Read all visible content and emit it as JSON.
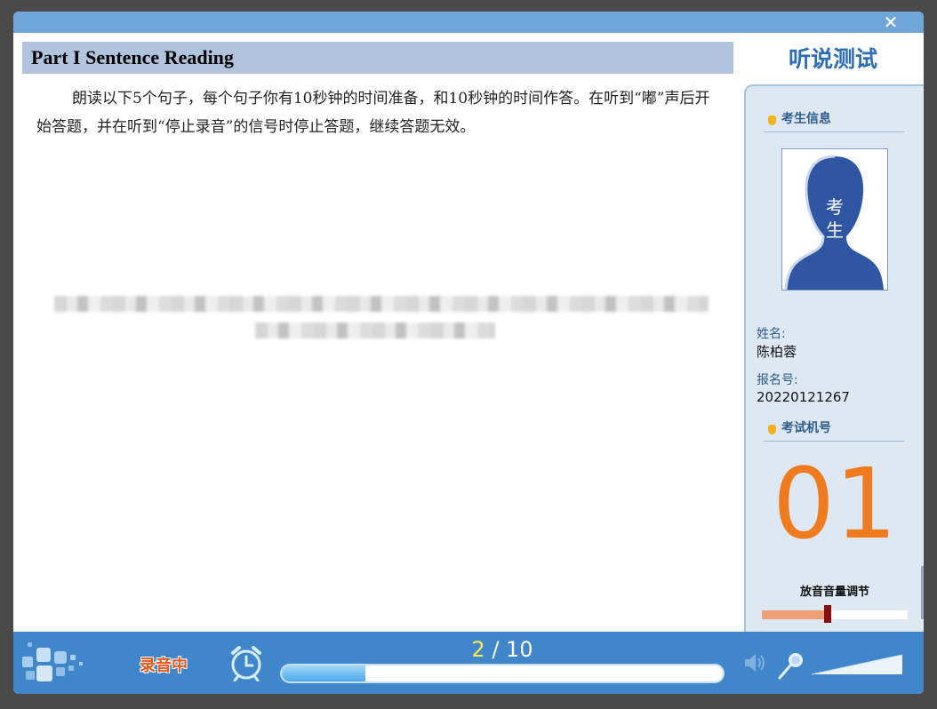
{
  "window": {
    "close_symbol": "✕"
  },
  "main": {
    "part_title": "Part I Sentence Reading",
    "instructions": "朗读以下5个句子，每个句子你有10秒钟的时间准备，和10秒钟的时间作答。在听到“嘟”声后开始答题，并在听到“停止录音”的信号时停止答题，继续答题无效。"
  },
  "sidebar": {
    "title": "听说测试",
    "candidate_section": "考生信息",
    "photo_caption_1": "考",
    "photo_caption_2": "生",
    "name_label": "姓名:",
    "name_value": "陈柏蓉",
    "reg_label": "报名号:",
    "reg_value": "20220121267",
    "machine_section": "考试机号",
    "machine_number": "01",
    "volume_label": "放音音量调节",
    "volume_level": 0.45
  },
  "bottom": {
    "recording_label": "录音中",
    "current_item": "2",
    "separator": " / ",
    "total_items": "10",
    "progress_fraction": 0.19
  },
  "icons": [
    "logo-squares-icon",
    "alarm-clock-icon",
    "speaker-icon",
    "microphone-icon",
    "volume-meter-icon",
    "close-icon",
    "candidate-silhouette-icon"
  ],
  "colors": {
    "accent_blue": "#3f86cb",
    "title_blue": "#2d6db5",
    "machine_orange": "#f07b1f",
    "recording_orange": "#e8571b",
    "counter_yellow": "#ffe94a"
  }
}
